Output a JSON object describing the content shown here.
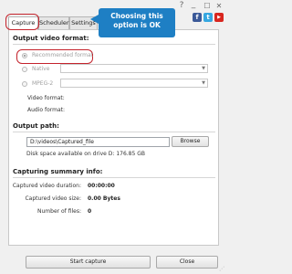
{
  "window": {
    "help_label": "?",
    "minimize_label": "_",
    "maximize_label": "☐",
    "close_label": "✕"
  },
  "social": [
    {
      "label": "f",
      "color": "#3b5998",
      "icon": "facebook-icon"
    },
    {
      "label": "t",
      "color": "#36a7e0",
      "icon": "twitter-icon"
    },
    {
      "label": "▶",
      "color": "#d8261f",
      "icon": "youtube-icon"
    }
  ],
  "tabs": [
    {
      "label": "Capture",
      "active": true
    },
    {
      "label": "Scheduler",
      "active": false
    },
    {
      "label": "Settings",
      "active": false
    }
  ],
  "callout": {
    "line1": "Choosing this",
    "line2": "option is OK",
    "color": "#1e7fc4"
  },
  "output_format": {
    "header": "Output video format:",
    "options": [
      {
        "label": "Recommended format",
        "selected": true
      },
      {
        "label": "Native",
        "selected": false
      },
      {
        "label": "MPEG-2",
        "selected": false
      }
    ],
    "video_format_label": "Video format:",
    "audio_format_label": "Audio format:"
  },
  "output_path": {
    "header": "Output path:",
    "value": "D:\\videos\\Captured_file",
    "browse_label": "Browse",
    "disk_space": "Disk space available on drive D: 176.85 GB"
  },
  "summary": {
    "header": "Capturing summary info:",
    "rows": [
      {
        "label": "Captured video duration:",
        "value": "00:00:00"
      },
      {
        "label": "Captured video size:",
        "value": "0.00 Bytes"
      },
      {
        "label": "Number of files:",
        "value": "0"
      }
    ]
  },
  "footer": {
    "start_label": "Start capture",
    "close_label": "Close"
  },
  "highlight_color": "#c4232c"
}
